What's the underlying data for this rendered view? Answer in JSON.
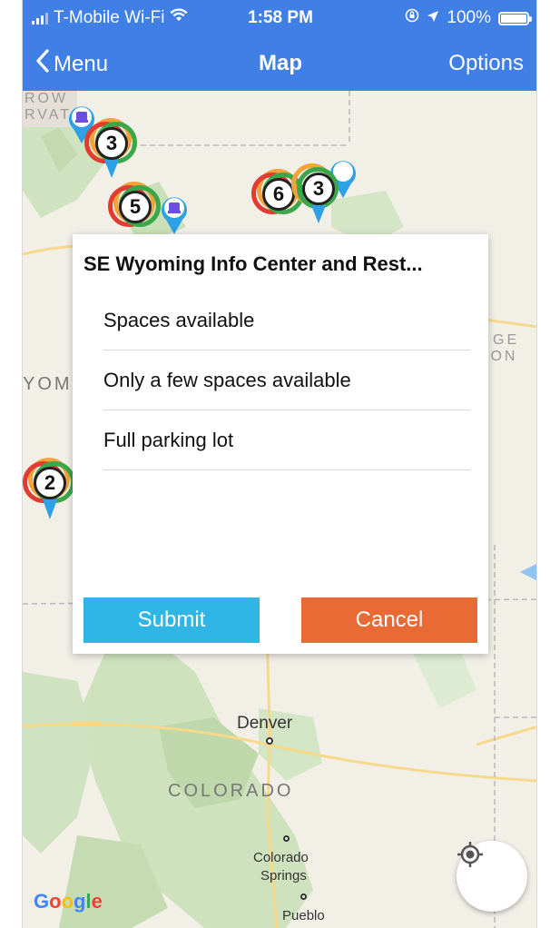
{
  "status_bar": {
    "carrier": "T-Mobile Wi-Fi",
    "time": "1:58 PM",
    "battery": "100%"
  },
  "nav": {
    "back_label": "Menu",
    "title": "Map",
    "options_label": "Options"
  },
  "map": {
    "labels": {
      "denver": "Denver",
      "colorado": "COLORADO",
      "colorado_springs_1": "Colorado",
      "colorado_springs_2": "Springs",
      "pueblo": "Pueblo",
      "wyoming_partial": "YOMI",
      "top_left_1": "ROW",
      "top_left_2": "RVAT",
      "right_1": "GE",
      "right_2": "ION"
    },
    "clusters": [
      {
        "count": "3"
      },
      {
        "count": "5"
      },
      {
        "count": "6"
      },
      {
        "count": "3"
      },
      {
        "count": "2"
      }
    ],
    "google": [
      "G",
      "o",
      "o",
      "g",
      "l",
      "e"
    ]
  },
  "dialog": {
    "title": "SE Wyoming Info Center and Rest...",
    "options": [
      "Spaces available",
      "Only a few spaces available",
      "Full parking lot"
    ],
    "submit_label": "Submit",
    "cancel_label": "Cancel"
  },
  "colors": {
    "brand_blue": "#3f7fe6",
    "submit": "#2fb6e5",
    "cancel": "#e86a35"
  }
}
